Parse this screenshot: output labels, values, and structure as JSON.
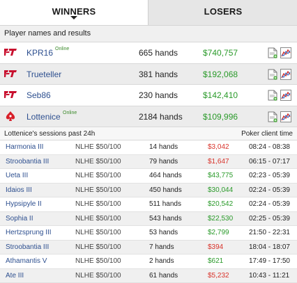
{
  "tabs": {
    "winners": "WINNERS",
    "losers": "LOSERS"
  },
  "section_title": "Player names and results",
  "players": [
    {
      "name": "KPR16",
      "online": "Online",
      "hands": "665 hands",
      "result": "$740,757",
      "logo": "fulltilt-logo"
    },
    {
      "name": "Trueteller",
      "online": "",
      "hands": "381 hands",
      "result": "$192,068",
      "logo": "fulltilt-logo"
    },
    {
      "name": "Seb86",
      "online": "",
      "hands": "230 hands",
      "result": "$142,410",
      "logo": "fulltilt-logo"
    },
    {
      "name": "Lottenice",
      "online": "Online",
      "hands": "2184 hands",
      "result": "$109,996",
      "logo": "pokerstars-logo"
    }
  ],
  "sessions": {
    "title": "Lottenice's sessions past 24h",
    "time_label": "Poker client time",
    "rows": [
      {
        "table": "Harmonia III",
        "game": "NLHE $50/100",
        "hands": "14 hands",
        "result": "$3,042",
        "negative": true,
        "time": "08:24 - 08:38"
      },
      {
        "table": "Stroobantia III",
        "game": "NLHE $50/100",
        "hands": "79 hands",
        "result": "$1,647",
        "negative": true,
        "time": "06:15 - 07:17"
      },
      {
        "table": "Ueta III",
        "game": "NLHE $50/100",
        "hands": "464 hands",
        "result": "$43,775",
        "negative": false,
        "time": "02:23 - 05:39"
      },
      {
        "table": "Idaios III",
        "game": "NLHE $50/100",
        "hands": "450 hands",
        "result": "$30,044",
        "negative": false,
        "time": "02:24 - 05:39"
      },
      {
        "table": "Hypsipyle II",
        "game": "NLHE $50/100",
        "hands": "511 hands",
        "result": "$20,542",
        "negative": false,
        "time": "02:24 - 05:39"
      },
      {
        "table": "Sophia II",
        "game": "NLHE $50/100",
        "hands": "543 hands",
        "result": "$22,530",
        "negative": false,
        "time": "02:25 - 05:39"
      },
      {
        "table": "Hertzsprung III",
        "game": "NLHE $50/100",
        "hands": "53 hands",
        "result": "$2,799",
        "negative": false,
        "time": "21:50 - 22:31"
      },
      {
        "table": "Stroobantia III",
        "game": "NLHE $50/100",
        "hands": "7 hands",
        "result": "$394",
        "negative": true,
        "time": "18:04 - 18:07"
      },
      {
        "table": "Athamantis V",
        "game": "NLHE $50/100",
        "hands": "2 hands",
        "result": "$621",
        "negative": false,
        "time": "17:49 - 17:50"
      },
      {
        "table": "Ate III",
        "game": "NLHE $50/100",
        "hands": "61 hands",
        "result": "$5,232",
        "negative": true,
        "time": "10:43 - 11:21"
      }
    ]
  },
  "colors": {
    "positive": "#2a9a2a",
    "negative": "#d8322a",
    "link": "#2d4f8f"
  }
}
